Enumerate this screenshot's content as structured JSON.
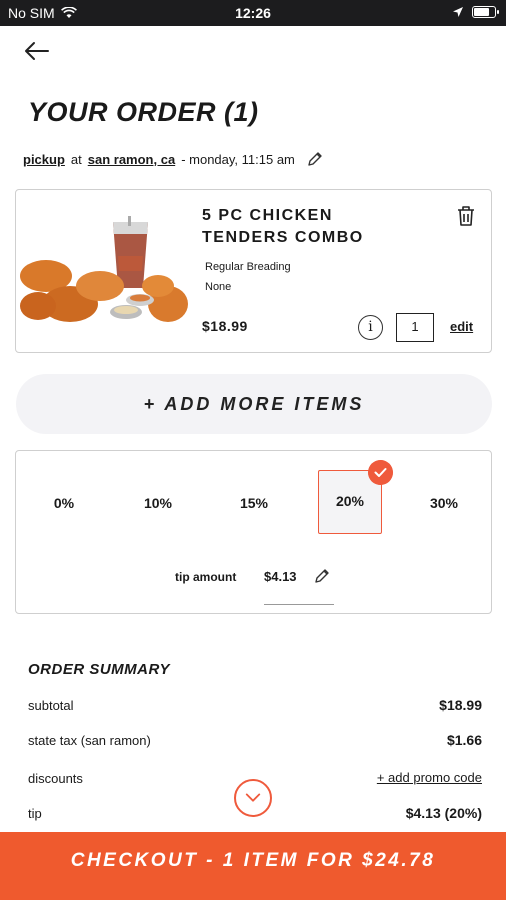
{
  "status_bar": {
    "carrier": "No SIM",
    "time": "12:26"
  },
  "header": {
    "title": "YOUR ORDER (1)"
  },
  "pickup": {
    "mode": "pickup",
    "at_word": "at",
    "location": "san ramon, ca",
    "when": "- monday, 11:15 am"
  },
  "item": {
    "name_line1": "5 PC CHICKEN",
    "name_line2": "TENDERS COMBO",
    "option1": "Regular Breading",
    "option2": "None",
    "price": "$18.99",
    "quantity": "1",
    "edit_label": "edit",
    "info_glyph": "i"
  },
  "add_more": {
    "label": "+ ADD MORE ITEMS"
  },
  "tip": {
    "options": [
      "0%",
      "10%",
      "15%",
      "20%",
      "30%"
    ],
    "selected": "20%",
    "amount_label": "tip amount",
    "amount": "$4.13"
  },
  "summary": {
    "title": "ORDER SUMMARY",
    "rows": [
      {
        "label": "subtotal",
        "value": "$18.99"
      },
      {
        "label": "state tax (san ramon)",
        "value": "$1.66"
      },
      {
        "label": "discounts",
        "value": "+ add promo code"
      },
      {
        "label": "tip",
        "value": "$4.13 (20%)"
      }
    ]
  },
  "checkout": {
    "label": "CHECKOUT - 1 ITEM FOR $24.78"
  },
  "colors": {
    "accent": "#ef5a2e",
    "selected_border": "#ef5a3c",
    "light_bg": "#f3f3f6"
  },
  "icons": [
    "wifi-icon",
    "location-arrow-icon",
    "battery-icon",
    "back-arrow-icon",
    "pencil-icon",
    "trash-icon",
    "info-icon",
    "checkmark-icon",
    "chevron-down-icon"
  ]
}
